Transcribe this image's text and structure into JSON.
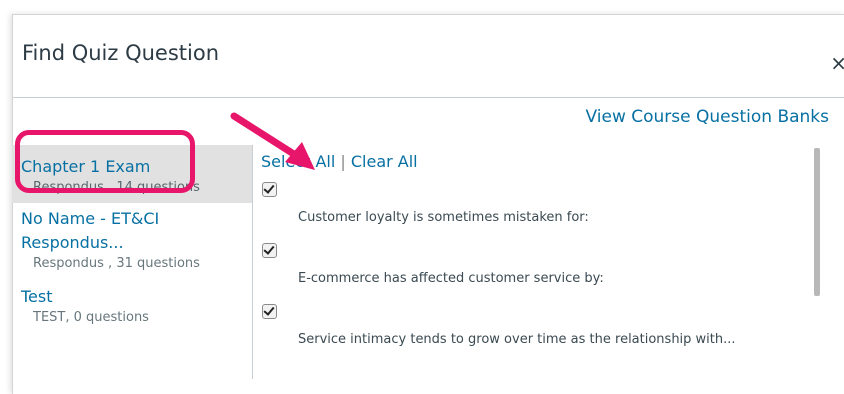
{
  "dialog": {
    "title": "Find Quiz Question",
    "close_glyph": "×",
    "view_banks_link": "View Course Question Banks"
  },
  "banks": [
    {
      "name": "Chapter 1 Exam",
      "meta": "Respondus , 14 questions",
      "selected": true
    },
    {
      "name": "No Name - ET&CI Respondus...",
      "meta": "Respondus , 31 questions",
      "selected": false
    },
    {
      "name": "Test",
      "meta": "TEST, 0 questions",
      "selected": false
    }
  ],
  "selection": {
    "select_all": "Select All",
    "separator": "|",
    "clear_all": "Clear All"
  },
  "questions": [
    {
      "text": "Customer loyalty is sometimes mistaken for:",
      "checked": true
    },
    {
      "text": "E-commerce has affected customer service by:",
      "checked": true
    },
    {
      "text": "Service intimacy tends to grow over time as the relationship with...",
      "checked": true
    }
  ],
  "colors": {
    "link": "#0770a3",
    "highlight": "#e8166a"
  }
}
